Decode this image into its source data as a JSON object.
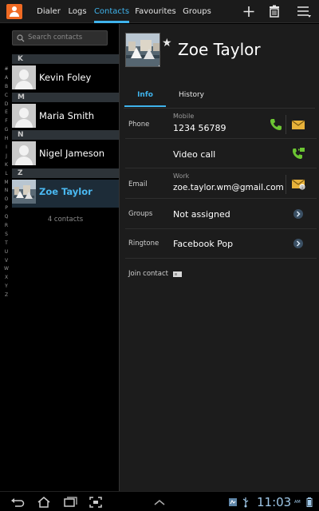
{
  "top_bar": {
    "tabs": [
      {
        "label": "Dialer"
      },
      {
        "label": "Logs"
      },
      {
        "label": "Contacts"
      },
      {
        "label": "Favourites"
      },
      {
        "label": "Groups"
      }
    ],
    "active_tab": "Contacts",
    "icons": [
      "contacts-app-icon",
      "add-icon",
      "delete-icon",
      "menu-icon"
    ]
  },
  "contact_list": {
    "search_placeholder": "Search contacts",
    "alphabet": [
      "#",
      "A",
      "B",
      "C",
      "D",
      "E",
      "F",
      "G",
      "H",
      "I",
      "J",
      "K",
      "L",
      "M",
      "N",
      "O",
      "P",
      "Q",
      "R",
      "S",
      "T",
      "U",
      "V",
      "W",
      "X",
      "Y",
      "Z"
    ],
    "sections": [
      {
        "letter": "K",
        "contacts": [
          {
            "name": "Kevin Foley"
          }
        ]
      },
      {
        "letter": "M",
        "contacts": [
          {
            "name": "Maria Smith"
          }
        ]
      },
      {
        "letter": "N",
        "contacts": [
          {
            "name": "Nigel Jameson"
          }
        ]
      },
      {
        "letter": "Z",
        "contacts": [
          {
            "name": "Zoe Taylor"
          }
        ]
      }
    ],
    "selected": "Zoe Taylor",
    "count_text": "4 contacts"
  },
  "detail": {
    "name": "Zoe Taylor",
    "tabs": [
      {
        "label": "Info"
      },
      {
        "label": "History"
      }
    ],
    "active_tab": "Info",
    "phone": {
      "label": "Phone",
      "type": "Mobile",
      "number": "1234 56789"
    },
    "video_call": {
      "label": "Video call"
    },
    "email": {
      "label": "Email",
      "type": "Work",
      "address": "zoe.taylor.wm@gmail.com"
    },
    "groups": {
      "label": "Groups",
      "value": "Not assigned"
    },
    "ringtone": {
      "label": "Ringtone",
      "value": "Facebook Pop"
    },
    "join_contact": {
      "label": "Join contact"
    }
  },
  "system_bar": {
    "time": "11:03",
    "ampm": "AM"
  },
  "colors": {
    "accent": "#3fb3ec",
    "call_green": "#6cc533",
    "message_yellow": "#e8b23a",
    "top_bar_bg": "#1b1b1b",
    "detail_bg": "#1c1c1c"
  }
}
